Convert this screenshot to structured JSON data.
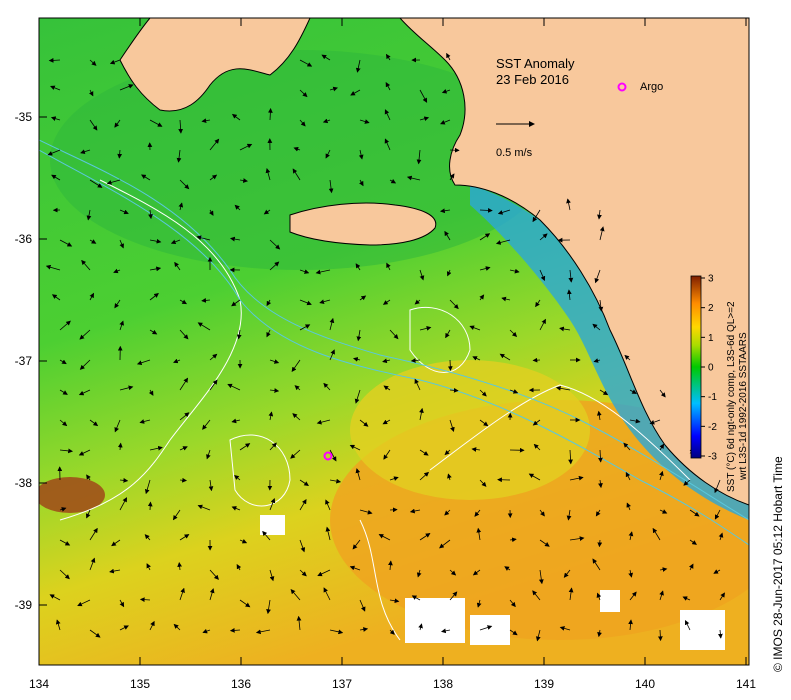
{
  "map": {
    "title": "SST Anomaly",
    "date": "23 Feb 2016",
    "marker_label": "Argo",
    "vector_scale_label": "0.5 m/s",
    "x_ticks": [
      "134",
      "135",
      "136",
      "137",
      "138",
      "139",
      "140",
      "141"
    ],
    "y_ticks": [
      "-35",
      "-36",
      "-37",
      "-38",
      "-39"
    ]
  },
  "colorbar": {
    "ticks": [
      "3",
      "2",
      "1",
      "0",
      "-1",
      "-2",
      "-3"
    ],
    "caption_line1": "SST (°C) 6d ngt-only comp, L3S-6d QL>=2",
    "caption_line2": "wrt L3S-1d 1992-2016 SSTAARS"
  },
  "credit": "© IMOS 28-Jun-2017 05:12 Hobart Time",
  "colors": {
    "land": "#f8c89c",
    "ocean_green": "#3cc83c",
    "ocean_light_green": "#78dc28",
    "ocean_yellow": "#e6d21e",
    "ocean_orange": "#f0a01e",
    "coastal_blue": "#28a0dc",
    "marker": "#ff00ff",
    "contour": "#ffffff",
    "track": "#50c8dc"
  }
}
